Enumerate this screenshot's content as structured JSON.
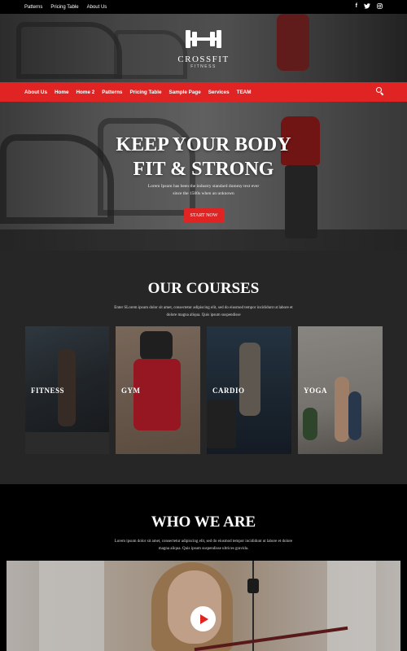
{
  "topbar": {
    "links": [
      "Patterns",
      "Pricing Table",
      "About Us"
    ],
    "social": [
      "f",
      "t",
      "ig"
    ]
  },
  "header": {
    "brand": "CROSSFIT",
    "brand_sub": "FITNESS"
  },
  "nav": {
    "items": [
      "About Us",
      "Home",
      "Home 2",
      "Patterns",
      "Pricing Table",
      "Sample Page",
      "Services",
      "TEAM"
    ]
  },
  "hero": {
    "headline_line1": "KEEP YOUR BODY",
    "headline_line2": "FIT & STRONG",
    "tagline_line1": "Lorem Ipsum has been the industry standard dummy text ever",
    "tagline_line2": "since the 1500s when an unknown",
    "cta_label": "START NOW"
  },
  "courses": {
    "title": "OUR COURSES",
    "desc_line1": "Enter SLorem ipsum dolor sit amet, consectetur adipiscing elit, sed do eiusmod tempor incididunt ut labore et",
    "desc_line2": "dolore magna aliqua. Quis ipsum suspendisse",
    "cards": [
      {
        "label": "FITNESS"
      },
      {
        "label": "GYM"
      },
      {
        "label": "CARDIO"
      },
      {
        "label": "YOGA"
      }
    ]
  },
  "who": {
    "title": "WHO WE ARE",
    "desc_line1": "Lorem ipsum dolor sit amet, consectetur adipiscing elit, sed do eiusmod tempor incididunt ut labore et dolore",
    "desc_line2": "magna aliqua. Quis ipsum suspendisse ultrices gravida."
  },
  "colors": {
    "accent": "#e02424",
    "dark_section": "#262626",
    "black": "#000000"
  },
  "icons": [
    "facebook-icon",
    "twitter-icon",
    "instagram-icon",
    "search-icon",
    "barbell-logo-icon",
    "play-icon"
  ]
}
